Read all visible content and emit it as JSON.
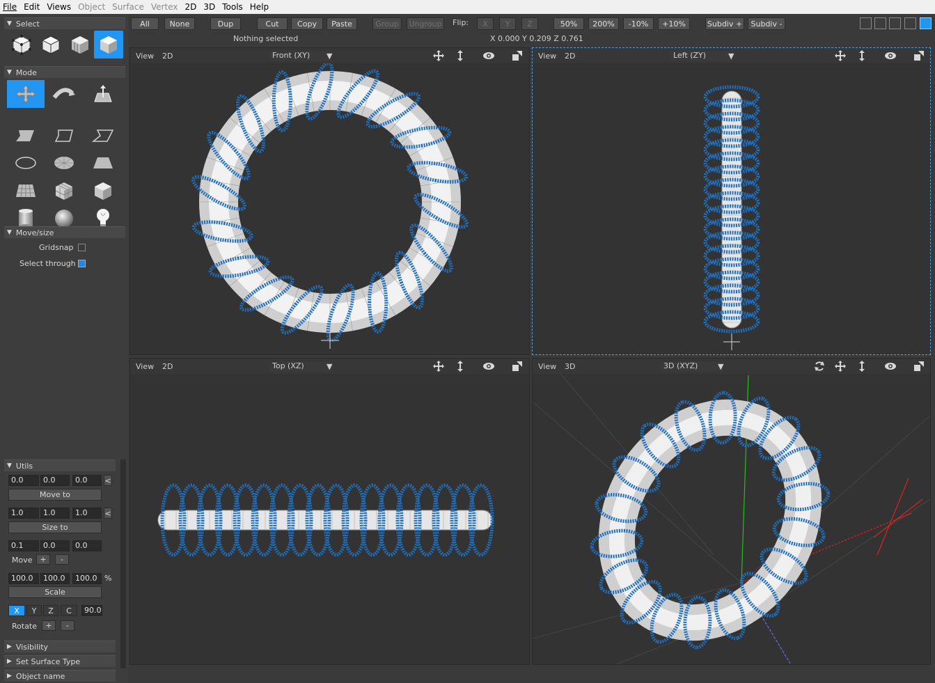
{
  "menu": {
    "file": "File",
    "edit": "Edit",
    "views": "Views",
    "object": "Object",
    "surface": "Surface",
    "vertex": "Vertex",
    "two_d": "2D",
    "three_d": "3D",
    "tools": "Tools",
    "help": "Help"
  },
  "toolbar": {
    "all": "All",
    "none": "None",
    "dup": "Dup",
    "cut": "Cut",
    "copy": "Copy",
    "paste": "Paste",
    "group": "Group",
    "ungroup": "Ungroup",
    "flip_label": "Flip:",
    "flip_x": "X",
    "flip_y": "Y",
    "flip_z": "Z",
    "zoom50": "50%",
    "zoom200": "200%",
    "minus10": "-10%",
    "plus10": "+10%",
    "subdiv_plus": "Subdiv +",
    "subdiv_minus": "Subdiv -"
  },
  "status": "Nothing selected",
  "coords": "X 0.000 Y 0.209 Z 0.761",
  "panels": {
    "select": "Select",
    "mode": "Mode",
    "movesize": "Move/size",
    "gridsnap": "Gridsnap",
    "select_through": "Select through",
    "utils": "Utils",
    "visibility": "Visibility",
    "set_surface_type": "Set Surface Type",
    "object_name": "Object name"
  },
  "toggles": {
    "gridsnap": false,
    "select_through": true
  },
  "utils": {
    "move_vals": [
      "0.0",
      "0.0",
      "0.0"
    ],
    "move_to": "Move to",
    "size_vals": [
      "1.0",
      "1.0",
      "1.0"
    ],
    "size_to": "Size to",
    "step_vals": [
      "0.1",
      "0.0",
      "0.0"
    ],
    "move": "Move",
    "plus": "+",
    "minus": "-",
    "lt": "<",
    "scale_vals": [
      "100.0",
      "100.0",
      "100.0"
    ],
    "pct": "%",
    "scale": "Scale",
    "axis_x": "X",
    "axis_y": "Y",
    "axis_z": "Z",
    "axis_c": "C",
    "angle": "90.0",
    "rotate": "Rotate"
  },
  "viewports": [
    {
      "view": "View",
      "dim": "2D",
      "proj": "Front (XY)"
    },
    {
      "view": "View",
      "dim": "2D",
      "proj": "Left (ZY)"
    },
    {
      "view": "View",
      "dim": "2D",
      "proj": "Top (XZ)"
    },
    {
      "view": "View",
      "dim": "3D",
      "proj": "3D (XYZ)"
    }
  ],
  "colors": {
    "accent": "#2196f3",
    "wire": "#1e6fbf",
    "axis_x": "#e02020",
    "axis_y": "#20c020",
    "axis_z": "#6a6af0"
  }
}
